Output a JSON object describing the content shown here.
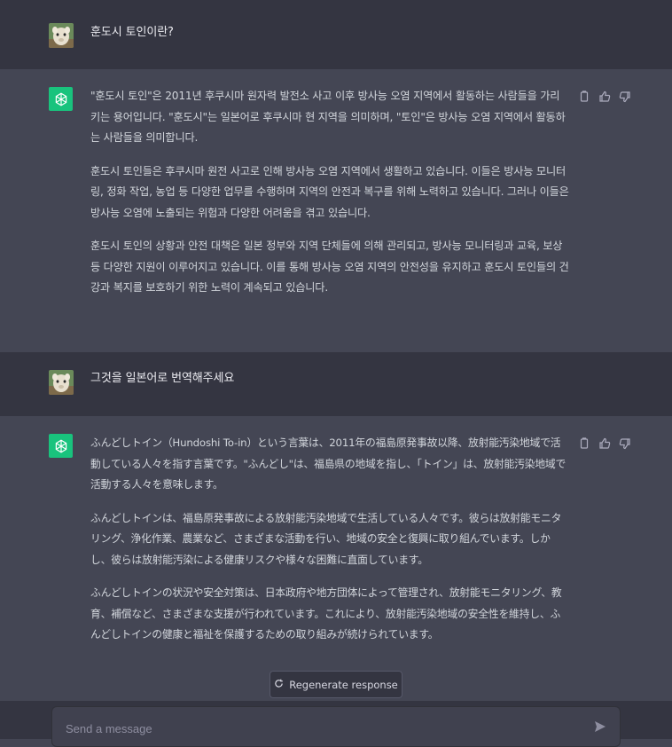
{
  "conversation": {
    "q1": "훈도시 토인이란?",
    "a1": [
      "\"훈도시 토인\"은 2011년 후쿠시마 원자력 발전소 사고 이후 방사능 오염 지역에서 활동하는 사람들을 가리키는 용어입니다. \"훈도시\"는 일본어로 후쿠시마 현 지역을 의미하며, \"토인\"은 방사능 오염 지역에서 활동하는 사람들을 의미합니다.",
      "훈도시 토인들은 후쿠시마 원전 사고로 인해 방사능 오염 지역에서 생활하고 있습니다. 이들은 방사능 모니터링, 정화 작업, 농업 등 다양한 업무를 수행하며 지역의 안전과 복구를 위해 노력하고 있습니다. 그러나 이들은 방사능 오염에 노출되는 위험과 다양한 어려움을 겪고 있습니다.",
      "훈도시 토인의 상황과 안전 대책은 일본 정부와 지역 단체들에 의해 관리되고, 방사능 모니터링과 교육, 보상 등 다양한 지원이 이루어지고 있습니다. 이를 통해 방사능 오염 지역의 안전성을 유지하고 훈도시 토인들의 건강과 복지를 보호하기 위한 노력이 계속되고 있습니다."
    ],
    "q2": "그것을 일본어로 번역해주세요",
    "a2": [
      "ふんどしトイン（Hundoshi To-in）という言葉は、2011年の福島原発事故以降、放射能汚染地域で活動している人々を指す言葉です。\"ふんどし\"は、福島県の地域を指し、「トイン」は、放射能汚染地域で活動する人々を意味します。",
      "ふんどしトインは、福島原発事故による放射能汚染地域で生活している人々です。彼らは放射能モニタリング、浄化作業、農業など、さまざまな活動を行い、地域の安全と復興に取り組んでいます。しかし、彼らは放射能汚染による健康リスクや様々な困難に直面しています。",
      "ふんどしトインの状況や安全対策は、日本政府や地方団体によって管理され、放射能モニタリング、教育、補償など、さまざまな支援が行われています。これにより、放射能汚染地域の安全性を維持し、ふんどしトインの健康と福祉を保護するための取り組みが続けられています。"
    ]
  },
  "regenerate_label": "Regenerate response",
  "input": {
    "placeholder": "Send a message"
  },
  "icons": [
    "copy-icon",
    "thumbs-up-icon",
    "thumbs-down-icon",
    "openai-logo-icon",
    "refresh-icon",
    "send-icon"
  ],
  "colors": {
    "user_bg": "#343541",
    "bot_bg": "#444654",
    "gpt_green": "#19c37d"
  }
}
